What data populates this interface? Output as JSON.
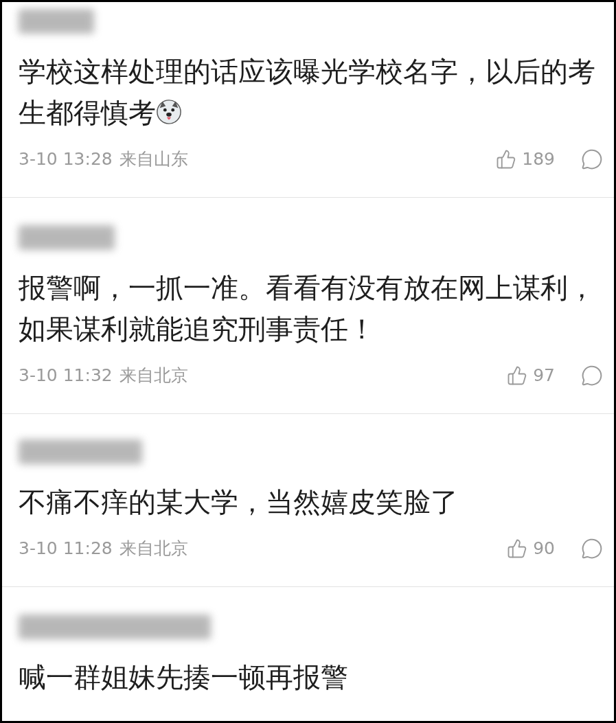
{
  "comments": [
    {
      "text": "学校这样处理的话应该曝光学校名字，以后的考生都得慎考",
      "has_emoji": true,
      "time": "3-10 13:28",
      "location": "来自山东",
      "likes": "189"
    },
    {
      "text": "报警啊，一抓一准。看看有没有放在网上谋利，如果谋利就能追究刑事责任！",
      "has_emoji": false,
      "time": "3-10 11:32",
      "location": "来自北京",
      "likes": "97"
    },
    {
      "text": "不痛不痒的某大学，当然嬉皮笑脸了",
      "has_emoji": false,
      "time": "3-10 11:28",
      "location": "来自北京",
      "likes": "90"
    },
    {
      "text": "喊一群姐妹先揍一顿再报警",
      "has_emoji": false
    }
  ]
}
